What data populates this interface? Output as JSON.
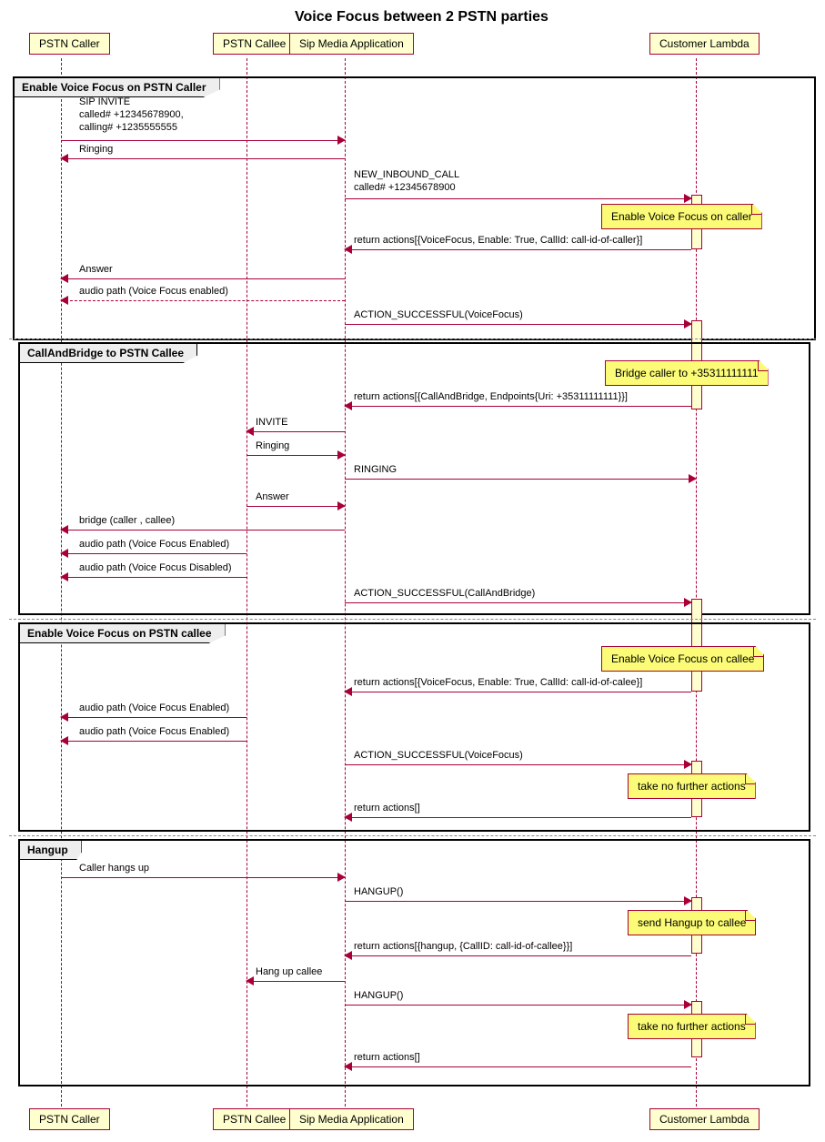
{
  "title": "Voice Focus between 2 PSTN parties",
  "participants": {
    "caller": "PSTN Caller",
    "callee": "PSTN Callee",
    "sma": "Sip Media Application",
    "lambda": "Customer Lambda"
  },
  "groups": {
    "g1": "Enable Voice Focus on PSTN Caller",
    "g2": "CallAndBridge to PSTN Callee",
    "g3": "Enable Voice Focus on PSTN callee",
    "g4": "Hangup"
  },
  "notes": {
    "n1": "Enable Voice Focus on caller",
    "n2": "Bridge caller to +35311111111",
    "n3": "Enable Voice Focus on callee",
    "n4": "take no further actions",
    "n5": "send Hangup to callee",
    "n6": "take no further actions"
  },
  "messages": {
    "m1": "SIP INVITE\ncalled# +12345678900,\ncalling# +1235555555",
    "m2": "Ringing",
    "m3": "NEW_INBOUND_CALL\ncalled# +12345678900",
    "m4": "return actions[{VoiceFocus, Enable: True, CallId: call-id-of-caller}]",
    "m5": "Answer",
    "m6": "audio path (Voice Focus enabled)",
    "m7": "ACTION_SUCCESSFUL(VoiceFocus)",
    "m8": "return actions[{CallAndBridge, Endpoints{Uri: +35311111111}}]",
    "m9": "INVITE",
    "m10": "Ringing",
    "m11": "RINGING",
    "m12": "Answer",
    "m13": "bridge (caller , callee)",
    "m14": "audio path (Voice Focus Enabled)",
    "m15": "audio path (Voice Focus Disabled)",
    "m16": "ACTION_SUCCESSFUL(CallAndBridge)",
    "m17": "return actions[{VoiceFocus, Enable: True, CallId: call-id-of-calee}]",
    "m18": "audio path (Voice Focus Enabled)",
    "m19": "audio path (Voice Focus Enabled)",
    "m20": "ACTION_SUCCESSFUL(VoiceFocus)",
    "m21": "return actions[]",
    "m22": "Caller hangs up",
    "m23": "HANGUP()",
    "m24": "return actions[{hangup, {CallID: call-id-of-callee}}]",
    "m25": "Hang up callee",
    "m26": "HANGUP()",
    "m27": "return actions[]"
  }
}
